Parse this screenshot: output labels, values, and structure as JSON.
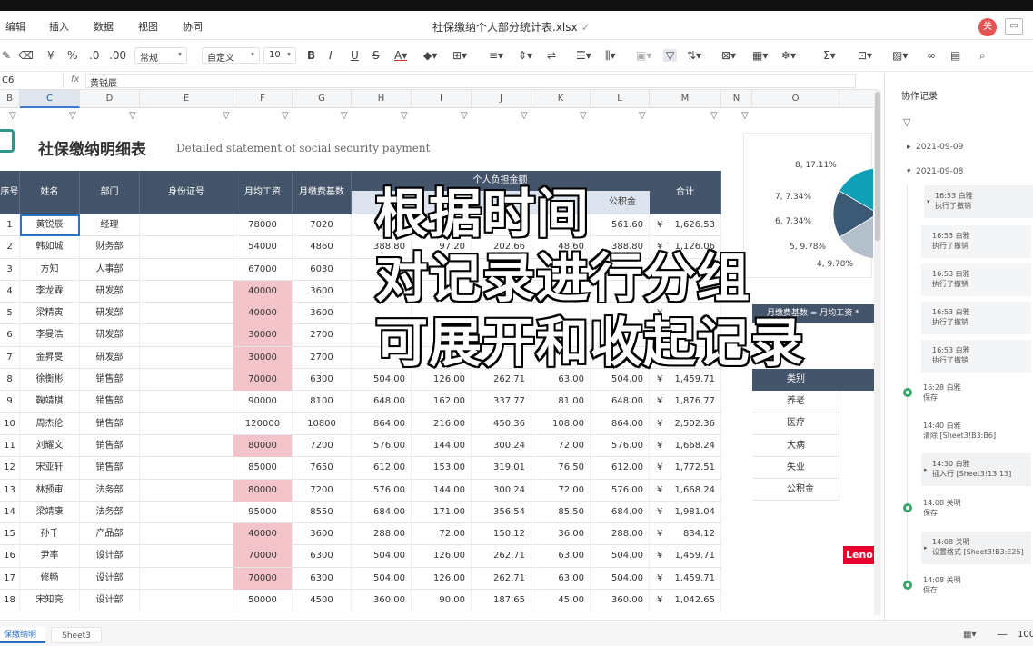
{
  "menu": {
    "items": [
      "编辑",
      "插入",
      "数据",
      "视图",
      "协同"
    ],
    "doc_title": "社保缴纳个人部分统计表.xlsx",
    "avatar": "关"
  },
  "toolbar": {
    "font_style": "常规",
    "number_format": "自定义",
    "font_size": "10"
  },
  "formula_bar": {
    "cell_ref": "C6",
    "fx": "fx",
    "value": "黄锐辰"
  },
  "columns": [
    "B",
    "C",
    "D",
    "E",
    "F",
    "G",
    "H",
    "I",
    "J",
    "K",
    "L",
    "M",
    "N",
    "O"
  ],
  "sheet": {
    "title": "社保缴纳明细表",
    "subtitle": "Detailed statement of social security payment"
  },
  "table": {
    "headers": {
      "no": "序号",
      "name": "姓名",
      "dept": "部门",
      "id": "身份证号",
      "wage": "月均工资",
      "base": "月缴费基数",
      "group": "个人负担金额",
      "gjj": "公积金",
      "total": "合计"
    },
    "rows": [
      {
        "no": "1",
        "name": "黄锐辰",
        "dept": "经理",
        "wage": "78000",
        "base": "7020",
        "h": "",
        "i": "",
        "j": "",
        "k": "",
        "l": "561.60",
        "yen": "¥",
        "total": "1,626.53",
        "pink": false
      },
      {
        "no": "2",
        "name": "韩如城",
        "dept": "财务部",
        "wage": "54000",
        "base": "4860",
        "h": "388.80",
        "i": "97.20",
        "j": "202.66",
        "k": "48.60",
        "l": "388.80",
        "yen": "¥",
        "total": "1,126.06",
        "pink": false
      },
      {
        "no": "3",
        "name": "方知",
        "dept": "人事部",
        "wage": "67000",
        "base": "6030",
        "h": "",
        "i": "",
        "j": "",
        "k": "",
        "l": "",
        "yen": "¥",
        "total": "",
        "pink": false
      },
      {
        "no": "4",
        "name": "李龙霖",
        "dept": "研发部",
        "wage": "40000",
        "base": "3600",
        "h": "",
        "i": "",
        "j": "",
        "k": "",
        "l": "",
        "yen": "¥",
        "total": "",
        "pink": true
      },
      {
        "no": "5",
        "name": "梁精寅",
        "dept": "研发部",
        "wage": "40000",
        "base": "3600",
        "h": "",
        "i": "",
        "j": "",
        "k": "",
        "l": "",
        "yen": "¥",
        "total": "",
        "pink": true
      },
      {
        "no": "6",
        "name": "李曼浩",
        "dept": "研发部",
        "wage": "30000",
        "base": "2700",
        "h": "",
        "i": "",
        "j": "",
        "k": "",
        "l": "",
        "yen": "¥",
        "total": "",
        "pink": true
      },
      {
        "no": "7",
        "name": "金昇旻",
        "dept": "研发部",
        "wage": "30000",
        "base": "2700",
        "h": "",
        "i": "",
        "j": "",
        "k": "",
        "l": "",
        "yen": "¥",
        "total": "",
        "pink": true
      },
      {
        "no": "8",
        "name": "徐衡彬",
        "dept": "销售部",
        "wage": "70000",
        "base": "6300",
        "h": "504.00",
        "i": "126.00",
        "j": "262.71",
        "k": "63.00",
        "l": "504.00",
        "yen": "¥",
        "total": "1,459.71",
        "pink": true
      },
      {
        "no": "9",
        "name": "鞠靖棋",
        "dept": "销售部",
        "wage": "90000",
        "base": "8100",
        "h": "648.00",
        "i": "162.00",
        "j": "337.77",
        "k": "81.00",
        "l": "648.00",
        "yen": "¥",
        "total": "1,876.77",
        "pink": false
      },
      {
        "no": "10",
        "name": "周杰伦",
        "dept": "销售部",
        "wage": "120000",
        "base": "10800",
        "h": "864.00",
        "i": "216.00",
        "j": "450.36",
        "k": "108.00",
        "l": "864.00",
        "yen": "¥",
        "total": "2,502.36",
        "pink": false
      },
      {
        "no": "11",
        "name": "刘耀文",
        "dept": "销售部",
        "wage": "80000",
        "base": "7200",
        "h": "576.00",
        "i": "144.00",
        "j": "300.24",
        "k": "72.00",
        "l": "576.00",
        "yen": "¥",
        "total": "1,668.24",
        "pink": true
      },
      {
        "no": "12",
        "name": "宋亚轩",
        "dept": "销售部",
        "wage": "85000",
        "base": "7650",
        "h": "612.00",
        "i": "153.00",
        "j": "319.01",
        "k": "76.50",
        "l": "612.00",
        "yen": "¥",
        "total": "1,772.51",
        "pink": false
      },
      {
        "no": "13",
        "name": "林预审",
        "dept": "法务部",
        "wage": "80000",
        "base": "7200",
        "h": "576.00",
        "i": "144.00",
        "j": "300.24",
        "k": "72.00",
        "l": "576.00",
        "yen": "¥",
        "total": "1,668.24",
        "pink": true
      },
      {
        "no": "14",
        "name": "梁靖康",
        "dept": "法务部",
        "wage": "95000",
        "base": "8550",
        "h": "684.00",
        "i": "171.00",
        "j": "356.54",
        "k": "85.50",
        "l": "684.00",
        "yen": "¥",
        "total": "1,981.04",
        "pink": false
      },
      {
        "no": "15",
        "name": "孙千",
        "dept": "产品部",
        "wage": "40000",
        "base": "3600",
        "h": "288.00",
        "i": "72.00",
        "j": "150.12",
        "k": "36.00",
        "l": "288.00",
        "yen": "¥",
        "total": "834.12",
        "pink": true
      },
      {
        "no": "16",
        "name": "尹率",
        "dept": "设计部",
        "wage": "70000",
        "base": "6300",
        "h": "504.00",
        "i": "126.00",
        "j": "262.71",
        "k": "63.00",
        "l": "504.00",
        "yen": "¥",
        "total": "1,459.71",
        "pink": true
      },
      {
        "no": "17",
        "name": "修畅",
        "dept": "设计部",
        "wage": "70000",
        "base": "6300",
        "h": "504.00",
        "i": "126.00",
        "j": "262.71",
        "k": "63.00",
        "l": "504.00",
        "yen": "¥",
        "total": "1,459.71",
        "pink": true
      },
      {
        "no": "18",
        "name": "宋知亮",
        "dept": "设计部",
        "wage": "50000",
        "base": "4500",
        "h": "360.00",
        "i": "90.00",
        "j": "187.65",
        "k": "45.00",
        "l": "360.00",
        "yen": "¥",
        "total": "1,042.65",
        "pink": false
      }
    ]
  },
  "chart_data": {
    "type": "pie",
    "labels": [
      "8, 17.11%",
      "7, 7.34%",
      "6, 7.34%",
      "5, 9.78%",
      "4, 9.78%"
    ],
    "colors": [
      "#17b7cc",
      "#1a8fd8",
      "#2f6f9a",
      "#5d7d97",
      "#8a9aa8",
      "#b3bfca",
      "#3c5a75",
      "#0fa0b8"
    ]
  },
  "side": {
    "formula_banner": "月缴费基数 = 月均工资 *",
    "category_header": "类别",
    "categories": [
      "养老",
      "医疗",
      "大病",
      "失业",
      "公积金"
    ],
    "brand": "Leno"
  },
  "panel": {
    "title": "协作记录",
    "groups": [
      {
        "date": "2021-09-09",
        "expanded": false
      },
      {
        "date": "2021-09-08",
        "expanded": true
      }
    ],
    "records": [
      {
        "time_user": "16:53 白雅",
        "action": "执行了撤销"
      },
      {
        "time_user": "16:53 白雅",
        "action": "执行了撤销"
      },
      {
        "time_user": "16:53 白雅",
        "action": "执行了撤销"
      },
      {
        "time_user": "16:53 白雅",
        "action": "执行了撤销"
      },
      {
        "time_user": "16:53 白雅",
        "action": "执行了撤销"
      },
      {
        "time_user": "16:28 白雅",
        "action": "保存"
      },
      {
        "time_user": "14:40 白雅",
        "action": "清除 [Sheet3!B3:B6]"
      },
      {
        "time_user": "14:30 白雅",
        "action": "插入行 [Sheet3!13:13]"
      },
      {
        "time_user": "14:08 关明",
        "action": "保存"
      },
      {
        "time_user": "14:08 关明",
        "action": "设置格式 [Sheet3!B3:E25]"
      },
      {
        "time_user": "14:08 关明",
        "action": "保存"
      }
    ]
  },
  "bottom": {
    "tabs": [
      "保缴纳明细",
      "Sheet3"
    ],
    "zoom": "100"
  },
  "caption": {
    "lines": [
      "根据时间",
      "对记录进行分组",
      "可展开和收起记录"
    ]
  }
}
